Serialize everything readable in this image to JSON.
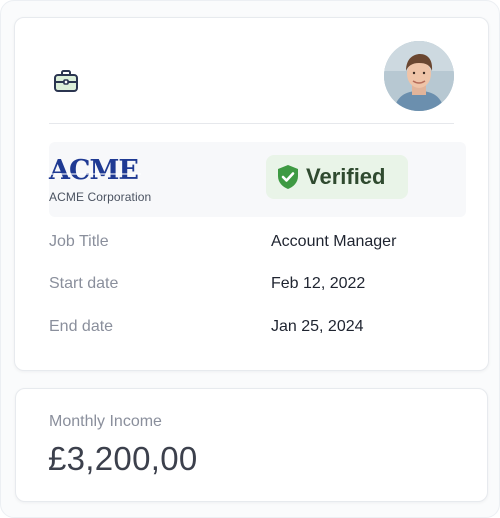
{
  "employment": {
    "briefcase_icon": "briefcase-icon",
    "avatar_icon": "person-avatar",
    "employer": {
      "logo_text": "ACME",
      "company_name": "ACME Corporation"
    },
    "verification": {
      "icon": "shield-check-icon",
      "label": "Verified",
      "color": "#3e9a43"
    },
    "details": [
      {
        "label": "Job Title",
        "value": "Account Manager"
      },
      {
        "label": "Start date",
        "value": "Feb 12, 2022"
      },
      {
        "label": "End date",
        "value": "Jan 25, 2024"
      }
    ]
  },
  "income": {
    "label": "Monthly Income",
    "value": "£3,200,00"
  },
  "colors": {
    "brand_blue": "#1f3a93",
    "verified_green": "#3e9a43",
    "verified_bg": "#e9f4e8"
  }
}
